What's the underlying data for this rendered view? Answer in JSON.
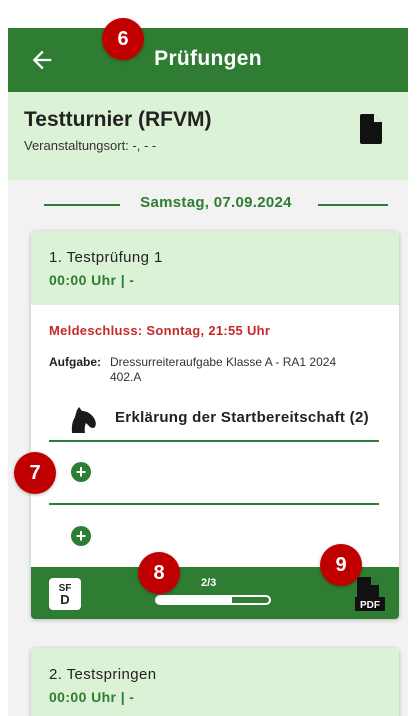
{
  "appbar": {
    "title": "Prüfungen"
  },
  "event": {
    "title": "Testturnier (RFVM)",
    "place": "Veranstaltungsort: -, - -"
  },
  "date_header": "Samstag, 07.09.2024",
  "competitions": [
    {
      "title": "1. Testprüfung 1",
      "time": "00:00 Uhr | -",
      "deadline": "Meldeschluss:  Sonntag, 21:55 Uhr",
      "task_label": "Aufgabe:",
      "task_value": "Dressurreiteraufgabe Klasse A - RA1 2024 402.A",
      "readiness_label": "Erklärung der Startbereitschaft (2)",
      "badge_top": "SF",
      "badge_bottom": "D",
      "progress_text": "2/3",
      "progress": 0.67
    },
    {
      "title": "2. Testspringen",
      "time": "00:00 Uhr | -"
    }
  ],
  "markers": [
    "6",
    "7",
    "8",
    "9"
  ],
  "colors": {
    "primary": "#2e7d32",
    "header_bg": "#dcf2d6",
    "deadline": "#c62828",
    "marker": "#c00000"
  },
  "icons": {
    "back": "arrow-left-icon",
    "document": "document-icon",
    "horse": "horse-head-icon",
    "add": "plus-circle-icon",
    "pdf": "pdf-file-icon"
  }
}
